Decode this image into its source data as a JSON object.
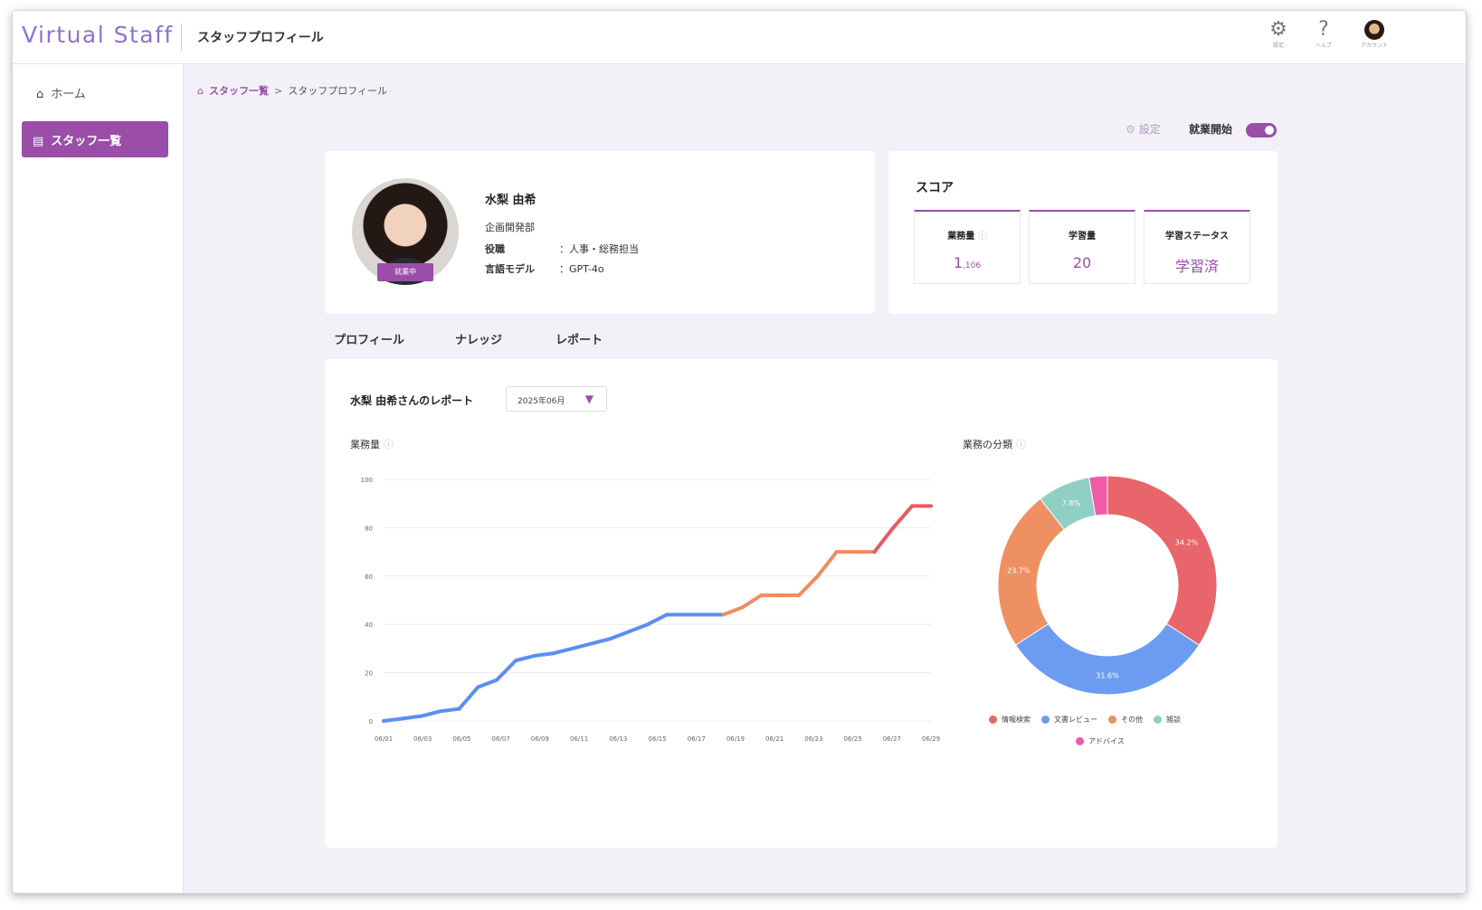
{
  "app": {
    "brand": "Virtual Staff",
    "page_title": "スタッフプロフィール"
  },
  "top_icons": [
    {
      "icon": "gear-icon",
      "caption": "設定"
    },
    {
      "icon": "help-icon",
      "caption": "ヘルプ"
    },
    {
      "icon": "avatar-icon",
      "caption": "アカウント"
    }
  ],
  "sidebar": {
    "items": [
      {
        "label": "ホーム",
        "icon": "home-icon",
        "active": false
      },
      {
        "label": "スタッフ一覧",
        "icon": "staff-list-icon",
        "active": true
      }
    ]
  },
  "breadcrumb": {
    "items": [
      "スタッフ一覧",
      "スタッフプロフィール"
    ],
    "separator": ">"
  },
  "controls": {
    "settings_label": "設定",
    "work_start_label": "就業開始",
    "work_toggle_on": true
  },
  "profile": {
    "name": "水梨 由希",
    "status_badge": "就業中",
    "department": "企画開発部",
    "fields": [
      {
        "label": "役職",
        "value": "：人事・総務担当"
      },
      {
        "label": "言語モデル",
        "value": "：GPT-4o"
      }
    ]
  },
  "score": {
    "title": "スコア",
    "items": [
      {
        "label": "業務量",
        "info": "ⓘ",
        "value": "1",
        "unit": ",106"
      },
      {
        "label": "学習量",
        "info": "",
        "value": "20",
        "unit": ""
      },
      {
        "label": "学習ステータス",
        "info": "",
        "value": "学習済",
        "unit": ""
      }
    ]
  },
  "tabs": [
    {
      "label": "プロフィール",
      "active": false
    },
    {
      "label": "ナレッジ",
      "active": false
    },
    {
      "label": "レポート",
      "active": true
    }
  ],
  "report": {
    "title": "水梨 由希さんのレポート",
    "month": "2025年06月",
    "line_label": "業務量",
    "pie_label": "業務の分類"
  },
  "colors": {
    "accent": "#9a4ea8",
    "line_blue": "#5b8ff0",
    "line_orange": "#ee8c5f",
    "line_red": "#e85a62"
  },
  "chart_data": [
    {
      "type": "line",
      "title": "業務量",
      "x": [
        "06/01",
        "06/02",
        "06/03",
        "06/04",
        "06/05",
        "06/06",
        "06/07",
        "06/08",
        "06/09",
        "06/10",
        "06/11",
        "06/12",
        "06/13",
        "06/14",
        "06/15",
        "06/16",
        "06/17",
        "06/18",
        "06/19",
        "06/20",
        "06/21",
        "06/22",
        "06/23",
        "06/24",
        "06/25",
        "06/26",
        "06/27",
        "06/28",
        "06/29"
      ],
      "values": [
        0,
        1,
        2,
        4,
        5,
        14,
        17,
        25,
        27,
        28,
        30,
        32,
        34,
        37,
        40,
        44,
        44,
        44,
        44,
        47,
        52,
        52,
        52,
        60,
        70,
        70,
        70,
        80,
        89,
        89
      ],
      "x_tick_labels": [
        "06/01",
        "06/03",
        "06/05",
        "06/07",
        "06/09",
        "06/11",
        "06/13",
        "06/15",
        "06/17",
        "06/19",
        "06/21",
        "06/23",
        "06/25",
        "06/27",
        "06/29"
      ],
      "y_ticks": [
        0,
        20,
        40,
        60,
        80,
        100
      ],
      "ylim": [
        0,
        100
      ],
      "grid": true
    },
    {
      "type": "pie",
      "title": "業務の分類",
      "donut": true,
      "slices": [
        {
          "label": "情報検索",
          "value": 34.2,
          "display": "34.2%",
          "color": "#e8656b"
        },
        {
          "label": "文書レビュー",
          "value": 31.6,
          "display": "31.6%",
          "color": "#6c9cf2"
        },
        {
          "label": "その他",
          "value": 23.7,
          "display": "23.7%",
          "color": "#ef9063"
        },
        {
          "label": "雑談",
          "value": 7.8,
          "display": "7.8%",
          "color": "#8fcfc4"
        },
        {
          "label": "アドバイス",
          "value": 2.7,
          "display": "",
          "color": "#f05aa8"
        }
      ],
      "legend_position": "bottom"
    }
  ]
}
